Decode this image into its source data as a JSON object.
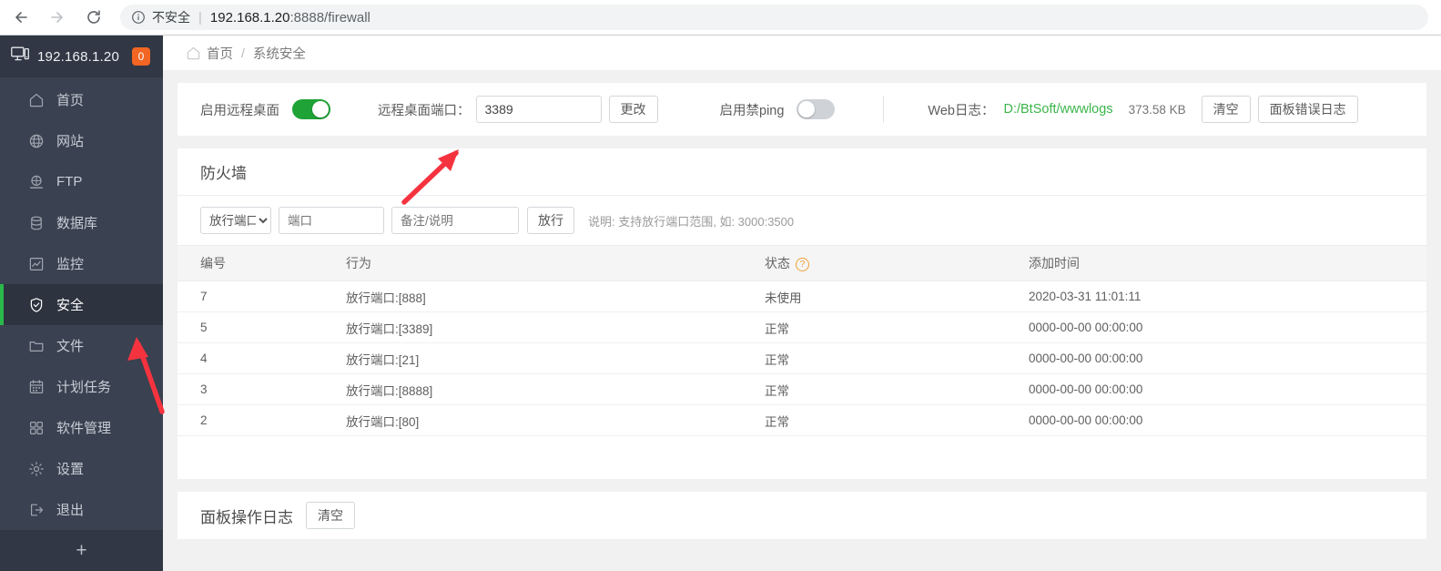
{
  "browser": {
    "back_icon": "back-arrow-icon",
    "forward_icon": "forward-arrow-icon",
    "reload_icon": "reload-icon",
    "info_icon": "info-circle-icon",
    "not_secure_label": "不安全",
    "separator": "|",
    "url_host": "192.168.1.20",
    "url_rest": ":8888/firewall"
  },
  "sidebar": {
    "host_icon": "monitor-icon",
    "host_name": "192.168.1.20",
    "badge": "0",
    "items": [
      {
        "label": "首页",
        "icon": "home-icon",
        "active": false
      },
      {
        "label": "网站",
        "icon": "globe-icon",
        "active": false
      },
      {
        "label": "FTP",
        "icon": "ftp-icon",
        "active": false
      },
      {
        "label": "数据库",
        "icon": "database-icon",
        "active": false
      },
      {
        "label": "监控",
        "icon": "chart-icon",
        "active": false
      },
      {
        "label": "安全",
        "icon": "shield-check-icon",
        "active": true
      },
      {
        "label": "文件",
        "icon": "folder-icon",
        "active": false
      },
      {
        "label": "计划任务",
        "icon": "calendar-icon",
        "active": false
      },
      {
        "label": "软件管理",
        "icon": "grid-icon",
        "active": false
      },
      {
        "label": "设置",
        "icon": "gear-icon",
        "active": false
      },
      {
        "label": "退出",
        "icon": "logout-icon",
        "active": false
      }
    ],
    "add_label": "+",
    "active_accent": "#2ab84a"
  },
  "breadcrumb": {
    "home_icon": "home-outline-icon",
    "home": "首页",
    "separator": "/",
    "current": "系统安全"
  },
  "toolbar": {
    "rdp_enable_label": "启用远程桌面",
    "rdp_enable_on": true,
    "rdp_port_label": "远程桌面端口：",
    "rdp_port_value": "3389",
    "change_button": "更改",
    "ping_label": "启用禁ping",
    "ping_on": false,
    "weblog_label": "Web日志：",
    "weblog_path": "D:/BtSoft/wwwlogs",
    "weblog_size": "373.58 KB",
    "clear_button": "清空",
    "panel_error_log_button": "面板错误日志",
    "weblog_path_color": "#3cb54a",
    "switch_on_color": "#1fa337"
  },
  "firewall": {
    "title": "防火墙",
    "action_select_value": "放行端口",
    "action_select_options": [
      "放行端口"
    ],
    "port_placeholder": "端口",
    "note_placeholder": "备注/说明",
    "allow_button": "放行",
    "hint": "说明: 支持放行端口范围, 如: 3000:3500",
    "table": {
      "columns": [
        "编号",
        "行为",
        "状态",
        "添加时间"
      ],
      "status_help_icon": "question-circle-icon",
      "rows": [
        {
          "id": "7",
          "action": "放行端口:[888]",
          "status": "未使用",
          "time": "2020-03-31 11:01:11"
        },
        {
          "id": "5",
          "action": "放行端口:[3389]",
          "status": "正常",
          "time": "0000-00-00 00:00:00"
        },
        {
          "id": "4",
          "action": "放行端口:[21]",
          "status": "正常",
          "time": "0000-00-00 00:00:00"
        },
        {
          "id": "3",
          "action": "放行端口:[8888]",
          "status": "正常",
          "time": "0000-00-00 00:00:00"
        },
        {
          "id": "2",
          "action": "放行端口:[80]",
          "status": "正常",
          "time": "0000-00-00 00:00:00"
        }
      ]
    }
  },
  "panel_log": {
    "title": "面板操作日志",
    "clear_button": "清空"
  },
  "annotations": {
    "color": "#f5333f",
    "arrow_1_name": "arrow-pointing-to-rdp-port-input",
    "arrow_2_name": "arrow-pointing-to-security-menu"
  }
}
